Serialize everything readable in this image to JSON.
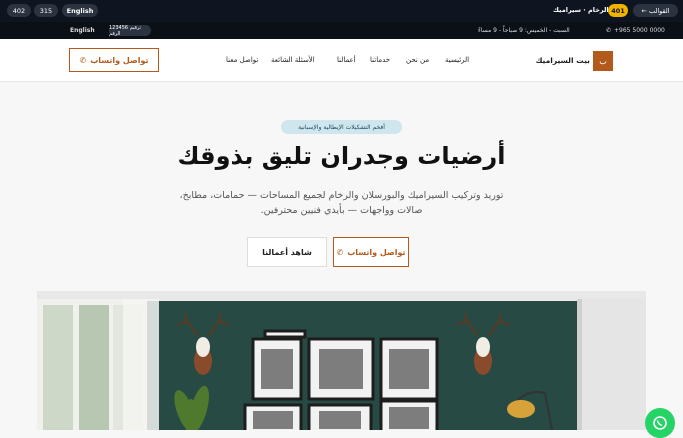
{
  "topbar": {
    "stat_left": "402",
    "stat_mid": "315",
    "language": "English",
    "back_label": "← القوالب",
    "count_badge": "401",
    "site_label": "الرخام · سيراميك"
  },
  "subbar": {
    "language": "English",
    "code_label": "123456 ترقيم الرقم",
    "hours": "السبت - الخميس: 9 صباحاً - 9 مساءً",
    "phone": "+965 5000 0000"
  },
  "nav": {
    "brand_letter": "ب",
    "brand_name": "بيت السيراميك",
    "links": [
      "الرئيسية",
      "من نحن",
      "خدماتنا",
      "أعمالنا",
      "الأسئلة الشائعة",
      "تواصل معنا"
    ],
    "cta_label": "تواصل واتساب"
  },
  "hero": {
    "badge": "أفخم التشكيلات الإيطالية والإسبانية",
    "title": "أرضيات وجدران تليق بذوقك",
    "subtitle": "توريد وتركيب السيراميك والبورسلان والرخام لجميع المساحات — حمامات، مطابخ، صالات وواجهات — بأيدي فنيين محترفين.",
    "primary_cta": "تواصل واتساب",
    "secondary_cta": "شاهد أعمالنا"
  },
  "colors": {
    "accent": "#b4591c",
    "dark": "#0f1520",
    "whatsapp": "#25d366",
    "wall": "#274a44"
  }
}
